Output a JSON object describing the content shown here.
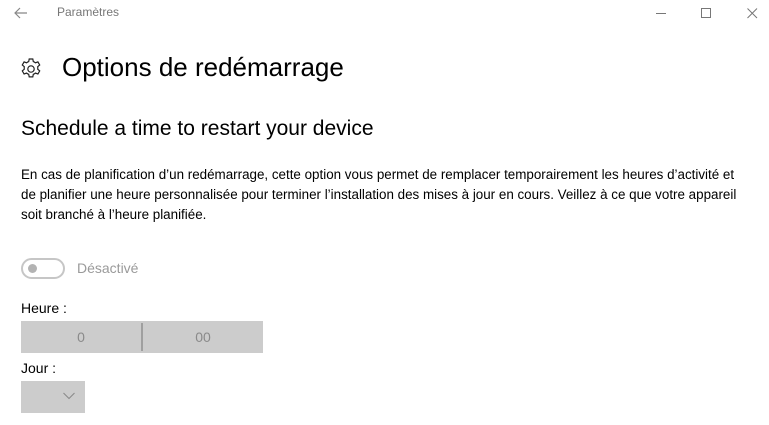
{
  "titlebar": {
    "title": "Paramètres",
    "back_icon": "back-arrow-icon",
    "minimize_icon": "minimize-icon",
    "maximize_icon": "maximize-icon",
    "close_icon": "close-icon"
  },
  "header": {
    "icon": "gear-icon",
    "title": "Options de redémarrage"
  },
  "section": {
    "title": "Schedule a time to restart your device",
    "description": "En cas de planification d’un redémarrage, cette option vous permet de remplacer temporairement les heures d’activité et de planifier une heure personnalisée pour terminer l’installation des mises à jour en cours. Veillez à ce que votre appareil soit branché à l’heure planifiée."
  },
  "toggle": {
    "state": "off",
    "label": "Désactivé"
  },
  "time": {
    "label": "Heure :",
    "hour": "0",
    "minute": "00"
  },
  "day": {
    "label": "Jour :",
    "selected": "",
    "icon": "chevron-down-icon"
  },
  "colors": {
    "background": "#ffffff",
    "picker_disabled": "#cccccc",
    "disabled_text": "#9a9a9a"
  }
}
